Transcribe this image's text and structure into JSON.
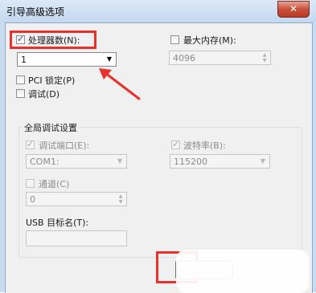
{
  "window": {
    "title": "引导高级选项",
    "close_glyph": "✕"
  },
  "processors": {
    "label": "处理器数(N):",
    "value": "1",
    "checked": true
  },
  "max_memory": {
    "label": "最大内存(M):",
    "value": "4096",
    "checked": false
  },
  "pci_lock": {
    "label": "PCI 锁定(P)",
    "checked": false
  },
  "debug": {
    "label": "调试(D)",
    "checked": false
  },
  "global_debug": {
    "title": "全局调试设置",
    "debug_port": {
      "label": "调试端口(E):",
      "value": "COM1:",
      "checked": true
    },
    "baud_rate": {
      "label": "波特率(B):",
      "value": "115200",
      "checked": true
    },
    "channel": {
      "label": "通道(C)",
      "value": "0",
      "checked": false
    },
    "usb_target": {
      "label": "USB 目标名(T):",
      "value": ""
    }
  },
  "colors": {
    "highlight": "#e8312a",
    "accent": "#2b4f9e"
  },
  "icons": {
    "dropdown": "chevron-down-icon",
    "spin_up": "caret-up-icon",
    "spin_down": "caret-down-icon"
  }
}
